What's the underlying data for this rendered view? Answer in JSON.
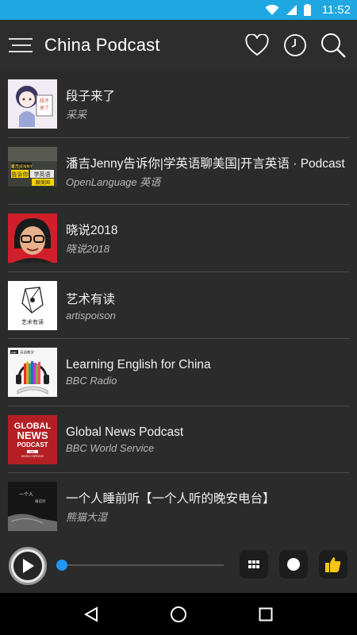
{
  "status_bar": {
    "time": "11:52",
    "icons": [
      "wifi-icon",
      "signal-icon",
      "battery-icon"
    ],
    "background": "#1ea7e1"
  },
  "app_bar": {
    "title": "China Podcast",
    "actions": [
      "heart-icon",
      "clock-icon",
      "search-icon"
    ],
    "menu_icon": "menu-icon"
  },
  "podcasts": [
    {
      "title": "段子来了",
      "author": "采采",
      "thumb_icon": "cartoon-character-artwork"
    },
    {
      "title": "潘吉Jenny告诉你|学英语聊美国|开言英语 · Podcast",
      "author": "OpenLanguage 英语",
      "thumb_icon": "jenny-podcast-artwork",
      "thumb_text": [
        "潘吉JENNY",
        "告诉你",
        "学英语",
        "聊美国"
      ]
    },
    {
      "title": "晓说2018",
      "author": "晓说2018",
      "thumb_icon": "host-portrait-artwork"
    },
    {
      "title": "艺术有读",
      "author": "artispoison",
      "thumb_icon": "sketch-artwork",
      "thumb_text": [
        "艺术有读"
      ]
    },
    {
      "title": "Learning English for China",
      "author": "BBC Radio",
      "thumb_icon": "headphones-books-artwork",
      "thumb_text": [
        "BBC",
        "英语教学"
      ]
    },
    {
      "title": "Global News Podcast",
      "author": "BBC World Service",
      "thumb_icon": "global-news-artwork",
      "thumb_text": [
        "GLOBAL",
        "NEWS",
        "PODCAST",
        "BBC",
        "WORLD SERVICE"
      ]
    },
    {
      "title": "一个人睡前听【一个人听的晚安电台】",
      "author": "熊猫大湿",
      "thumb_icon": "night-radio-artwork",
      "thumb_text": [
        "一个人",
        "睡前听"
      ]
    }
  ],
  "player": {
    "play_icon": "play-icon",
    "progress": 0.0,
    "buttons": [
      "grid-icon",
      "record-icon",
      "thumbs-up-icon"
    ],
    "accent": "#2196f3",
    "like_color": "#f5c518"
  },
  "nav": [
    "back-icon",
    "home-icon",
    "recents-icon"
  ]
}
